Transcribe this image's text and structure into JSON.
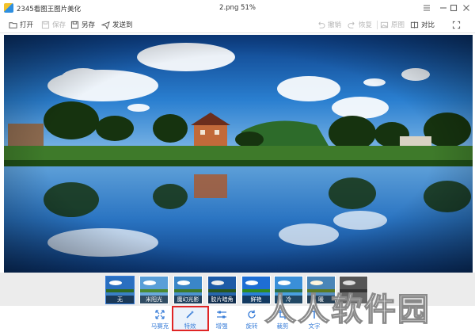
{
  "titlebar": {
    "app_title": "2345看图王图片美化",
    "file_title": "2.png   51%"
  },
  "toolbar": {
    "left": [
      {
        "label": "打开",
        "icon": "folder-icon",
        "enabled": true
      },
      {
        "label": "保存",
        "icon": "save-icon",
        "enabled": false
      },
      {
        "label": "另存",
        "icon": "save-as-icon",
        "enabled": true
      },
      {
        "label": "发送到",
        "icon": "send-icon",
        "enabled": true
      }
    ],
    "right": [
      {
        "label": "撤销",
        "icon": "undo-icon",
        "enabled": false
      },
      {
        "label": "恢复",
        "icon": "redo-icon",
        "enabled": false
      },
      {
        "label": "原图",
        "icon": "original-image-icon",
        "enabled": false
      },
      {
        "label": "对比",
        "icon": "compare-icon",
        "enabled": true
      }
    ]
  },
  "effects": [
    {
      "label": "无",
      "selected": true
    },
    {
      "label": "米阳光",
      "selected": false
    },
    {
      "label": "魔幻光影",
      "selected": false
    },
    {
      "label": "胶片暗角",
      "selected": false
    },
    {
      "label": "鲜艳",
      "selected": false
    },
    {
      "label": "冷",
      "selected": false
    },
    {
      "label": "暖",
      "selected": false
    },
    {
      "label": "",
      "selected": false
    }
  ],
  "bottom_tools": [
    {
      "label": "马赛克",
      "icon": "mosaic-icon",
      "active": false
    },
    {
      "label": "特效",
      "icon": "magic-wand-icon",
      "active": true
    },
    {
      "label": "增强",
      "icon": "sliders-icon",
      "active": false
    },
    {
      "label": "旋转",
      "icon": "rotate-icon",
      "active": false
    },
    {
      "label": "裁剪",
      "icon": "crop-icon",
      "active": false
    },
    {
      "label": "文字",
      "icon": "text-icon",
      "active": false
    }
  ],
  "watermark": "人人软件园",
  "colors": {
    "accent": "#3a7ed8",
    "highlight_border": "#e02525",
    "sky": "#1f63b8",
    "water": "#1d5fa8"
  }
}
